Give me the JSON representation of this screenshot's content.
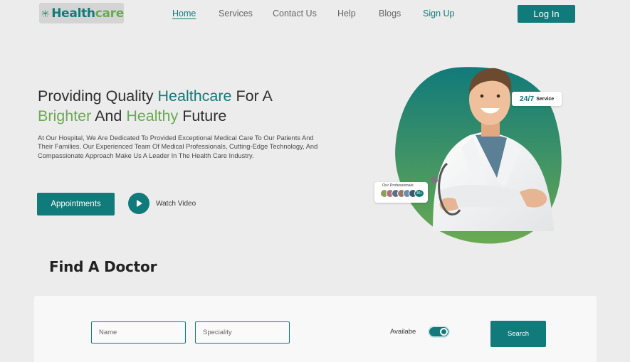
{
  "brand": {
    "name_part1": "Health",
    "name_part2": "care",
    "colors": {
      "primary": "#117a7a",
      "accent": "#6aaa52",
      "background": "#ececec"
    },
    "logo_icon": "tree-logo-icon"
  },
  "nav": {
    "items": [
      {
        "label": "Home",
        "active": true
      },
      {
        "label": "Services"
      },
      {
        "label": "Contact Us"
      },
      {
        "label": "Help"
      },
      {
        "label": "Blogs"
      },
      {
        "label": "Sign Up"
      }
    ],
    "login_label": "Log In"
  },
  "hero": {
    "title_part1": "Providing Quality ",
    "title_highlight1": "Healthcare",
    "title_part2": " For A ",
    "title_highlight2": "Brighter",
    "title_part3": " And ",
    "title_highlight3": "Healthy",
    "title_part4": " Future",
    "description": "At Our Hospital, We Are Dedicated To Provided Exceptional Medical Care To Our Patients And Their Families. Our Experienced Team Of Medical Professionals, Cutting-Edge Technology, And Compassionate Approach Make Us A Leader In The Health Care Industry.",
    "primary_button": "Appointments",
    "video_label": "Watch Video",
    "badge_big": "24/7",
    "badge_small": "Service",
    "professionals_label": "Our Professionals",
    "professionals_more": "30+"
  },
  "find_doctor": {
    "title": "Find A Doctor",
    "name_placeholder": "Name",
    "speciality_placeholder": "Speciality",
    "available_label": "Availabe",
    "available_on": true,
    "search_label": "Search"
  }
}
